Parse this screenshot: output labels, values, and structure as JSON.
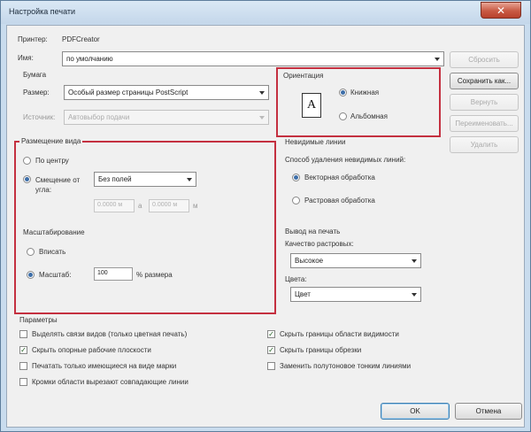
{
  "window": {
    "title": "Настройка печати"
  },
  "printer": {
    "label": "Принтер:",
    "name": "PDFCreator"
  },
  "preset": {
    "label": "Имя:",
    "value": "по умолчанию"
  },
  "paper": {
    "section_label": "Бумага",
    "size_label": "Размер:",
    "size_value": "Особый размер страницы PostScript",
    "source_label": "Источник:",
    "source_value": "Автовыбор подачи"
  },
  "orientation": {
    "section_label": "Ориентация",
    "portrait_label": "Книжная",
    "landscape_label": "Альбомная"
  },
  "placement": {
    "section_label": "Размещение вида",
    "center_label": "По центру",
    "offset_label": "Смещение от угла:",
    "offset_value": "Без полей",
    "x_value": "0.0000 м",
    "x_suffix": "а",
    "y_value": "0.0000 м",
    "y_suffix": "м"
  },
  "scaling": {
    "section_label": "Масштабирование",
    "fit_label": "Вписать",
    "zoom_label": "Масштаб:",
    "zoom_value": "100",
    "zoom_suffix": "% размера"
  },
  "hidden_lines": {
    "section_label": "Невидимые линии",
    "method_label": "Способ удаления невидимых линий:",
    "vector_label": "Векторная обработка",
    "raster_label": "Растровая обработка"
  },
  "output": {
    "section_label": "Вывод на печать",
    "quality_label": "Качество растровых:",
    "quality_value": "Высокое",
    "color_label": "Цвета:",
    "color_value": "Цвет"
  },
  "options": {
    "section_label": "Параметры",
    "items_left": [
      {
        "label": "Выделять связи видов (только цветная печать)",
        "checked": false
      },
      {
        "label": "Скрыть опорные рабочие плоскости",
        "checked": true
      },
      {
        "label": "Печатать только имеющиеся на виде марки",
        "checked": false
      },
      {
        "label": "Кромки области вырезают совпадающие линии",
        "checked": false
      }
    ],
    "items_right": [
      {
        "label": "Скрыть границы области видимости",
        "checked": true
      },
      {
        "label": "Скрыть границы обрезки",
        "checked": true
      },
      {
        "label": "Заменить полутоновое тонким линиями",
        "checked": false
      }
    ]
  },
  "buttons": {
    "reset": "Сбросить",
    "save_as": "Сохранить как...",
    "rename": "Вернуть",
    "rename2": "Переименовать...",
    "delete": "Удалить",
    "ok": "OK",
    "cancel": "Отмена"
  },
  "colors": {
    "highlight": "#c43040",
    "accent": "#3d6ea8"
  }
}
